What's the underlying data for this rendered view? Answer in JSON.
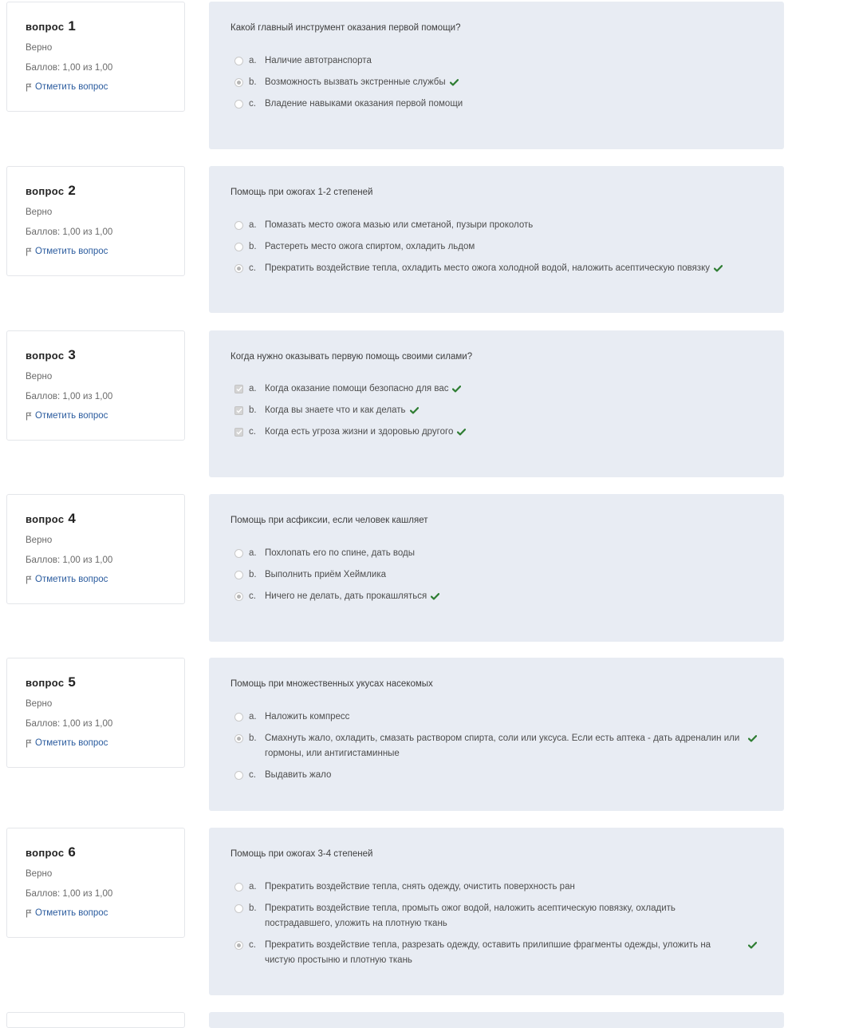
{
  "labels": {
    "question_prefix": "вопрос",
    "flag_label": "Отметить вопрос"
  },
  "colors": {
    "panel_bg": "#e8ecf3",
    "correct_tick": "#2e7d32",
    "flag_link": "#2a5b9e"
  },
  "questions": [
    {
      "number": "1",
      "state": "Верно",
      "grade": "Баллов: 1,00 из 1,00",
      "text": "Какой главный инструмент оказания первой помощи?",
      "input_type": "radio",
      "answers": [
        {
          "letter": "a.",
          "text": "Наличие автотранспорта",
          "selected": false,
          "correct": false
        },
        {
          "letter": "b.",
          "text": "Возможность вызвать экстренные службы",
          "selected": true,
          "correct": true
        },
        {
          "letter": "c.",
          "text": "Владение навыками оказания первой помощи",
          "selected": false,
          "correct": false
        }
      ]
    },
    {
      "number": "2",
      "state": "Верно",
      "grade": "Баллов: 1,00 из 1,00",
      "text": "Помощь при ожогах 1-2 степеней",
      "input_type": "radio",
      "answers": [
        {
          "letter": "a.",
          "text": "Помазать место ожога мазью или сметаной, пузыри проколоть",
          "selected": false,
          "correct": false
        },
        {
          "letter": "b.",
          "text": "Растереть место ожога спиртом, охладить льдом",
          "selected": false,
          "correct": false
        },
        {
          "letter": "c.",
          "text": "Прекратить воздействие тепла, охладить место ожога холодной водой, наложить асептическую повязку",
          "selected": true,
          "correct": true
        }
      ]
    },
    {
      "number": "3",
      "state": "Верно",
      "grade": "Баллов: 1,00 из 1,00",
      "text": "Когда нужно оказывать первую помощь своими силами?",
      "input_type": "checkbox",
      "answers": [
        {
          "letter": "a.",
          "text": "Когда оказание помощи безопасно для вас",
          "selected": true,
          "correct": true
        },
        {
          "letter": "b.",
          "text": "Когда вы знаете что и как делать",
          "selected": true,
          "correct": true
        },
        {
          "letter": "c.",
          "text": "Когда есть угроза жизни и здоровью другого",
          "selected": true,
          "correct": true
        }
      ]
    },
    {
      "number": "4",
      "state": "Верно",
      "grade": "Баллов: 1,00 из 1,00",
      "text": "Помощь при асфиксии, если человек кашляет",
      "input_type": "radio",
      "answers": [
        {
          "letter": "a.",
          "text": "Похлопать его по спине, дать воды",
          "selected": false,
          "correct": false
        },
        {
          "letter": "b.",
          "text": "Выполнить приём Хеймлика",
          "selected": false,
          "correct": false
        },
        {
          "letter": "c.",
          "text": "Ничего не делать, дать прокашляться",
          "selected": true,
          "correct": true
        }
      ]
    },
    {
      "number": "5",
      "state": "Верно",
      "grade": "Баллов: 1,00 из 1,00",
      "text": "Помощь при множественных укусах насекомых",
      "input_type": "radio",
      "answers": [
        {
          "letter": "a.",
          "text": "Наложить компресс",
          "selected": false,
          "correct": false
        },
        {
          "letter": "b.",
          "text": "Смахнуть жало, охладить, смазать раствором спирта, соли или уксуса. Если есть аптека - дать адреналин или гормоны, или антигистаминные",
          "selected": true,
          "correct": true
        },
        {
          "letter": "c.",
          "text": "Выдавить жало",
          "selected": false,
          "correct": false
        }
      ]
    },
    {
      "number": "6",
      "state": "Верно",
      "grade": "Баллов: 1,00 из 1,00",
      "text": "Помощь при ожогах 3-4 степеней",
      "input_type": "radio",
      "answers": [
        {
          "letter": "a.",
          "text": "Прекратить воздействие тепла, снять одежду, очистить поверхность ран",
          "selected": false,
          "correct": false
        },
        {
          "letter": "b.",
          "text": "Прекратить воздействие тепла, промыть ожог водой, наложить асептическую повязку, охладить пострадавшего, уложить на плотную ткань",
          "selected": false,
          "correct": false
        },
        {
          "letter": "c.",
          "text": "Прекратить воздействие тепла, разрезать одежду, оставить прилипшие фрагменты одежды, уложить на чистую простыню и плотную ткань",
          "selected": true,
          "correct": true
        }
      ]
    }
  ]
}
